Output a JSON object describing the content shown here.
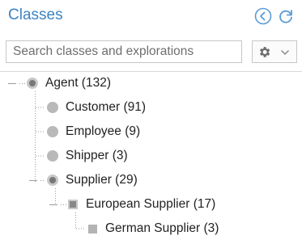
{
  "panel": {
    "title": "Classes",
    "back_icon": "circle-arrow-left-icon",
    "refresh_icon": "refresh-icon"
  },
  "search": {
    "placeholder": "Search classes and explorations",
    "value": ""
  },
  "settings": {
    "icon": "gear-icon",
    "dropdown_icon": "chevron-down-icon"
  },
  "tree": [
    {
      "label": "Agent (132)",
      "icon": "circle",
      "expanded": true
    },
    {
      "label": "Customer (91)",
      "icon": "circle"
    },
    {
      "label": "Employee (9)",
      "icon": "circle"
    },
    {
      "label": "Shipper (3)",
      "icon": "circle"
    },
    {
      "label": "Supplier (29)",
      "icon": "circle",
      "expanded": true
    },
    {
      "label": "European Supplier (17)",
      "icon": "square",
      "expanded": true
    },
    {
      "label": "German Supplier (3)",
      "icon": "square"
    }
  ],
  "colors": {
    "title": "#3c84c2",
    "icon_blue": "#5b9bd5",
    "tree_line": "#999999"
  }
}
